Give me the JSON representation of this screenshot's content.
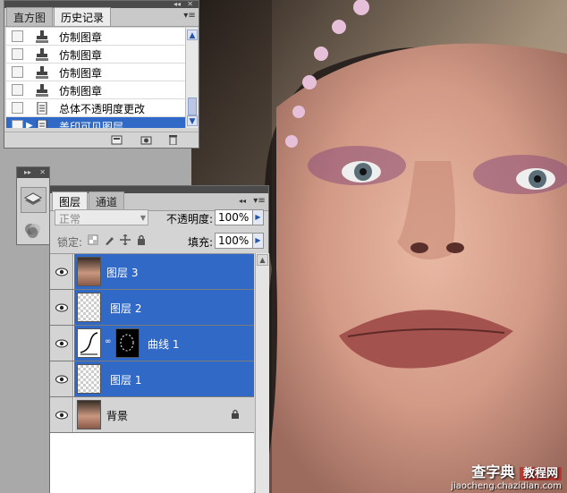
{
  "history_panel": {
    "tabs": [
      "直方图",
      "历史记录"
    ],
    "active_tab": 1,
    "items": [
      {
        "label": "仿制图章",
        "icon": "clone-stamp-icon"
      },
      {
        "label": "仿制图章",
        "icon": "clone-stamp-icon"
      },
      {
        "label": "仿制图章",
        "icon": "clone-stamp-icon"
      },
      {
        "label": "仿制图章",
        "icon": "clone-stamp-icon"
      },
      {
        "label": "总体不透明度更改",
        "icon": "document-icon"
      },
      {
        "label": "盖印可见图层",
        "icon": "document-icon",
        "selected": true
      }
    ],
    "footer_icons": [
      "new-document-from-state-icon",
      "snapshot-icon",
      "trash-icon"
    ]
  },
  "layers_panel": {
    "tabs": [
      "图层",
      "通道"
    ],
    "active_tab": 0,
    "blend_mode": "正常",
    "opacity_label": "不透明度:",
    "opacity_value": "100%",
    "lock_label": "锁定:",
    "fill_label": "填充:",
    "fill_value": "100%",
    "layers": [
      {
        "name": "图层 3",
        "thumb": "portrait",
        "selected": true,
        "visible": true
      },
      {
        "name": "图层 2",
        "thumb": "transparent",
        "selected": true,
        "visible": true
      },
      {
        "name": "曲线 1",
        "thumb": "curves-adjustment",
        "mask": true,
        "selected": true,
        "visible": true
      },
      {
        "name": "图层 1",
        "thumb": "transparent",
        "selected": true,
        "visible": true
      },
      {
        "name": "背景",
        "thumb": "portrait",
        "selected": false,
        "visible": true,
        "locked": true
      }
    ]
  },
  "watermark": {
    "logo": "查字典",
    "tag": "教程网",
    "url": "jiaocheng.chazidian.com"
  },
  "colors": {
    "selection": "#3169c6",
    "panel_bg": "#d4d4d4",
    "titlebar": "#4b4b4b",
    "workspace": "#a9a9a9"
  }
}
